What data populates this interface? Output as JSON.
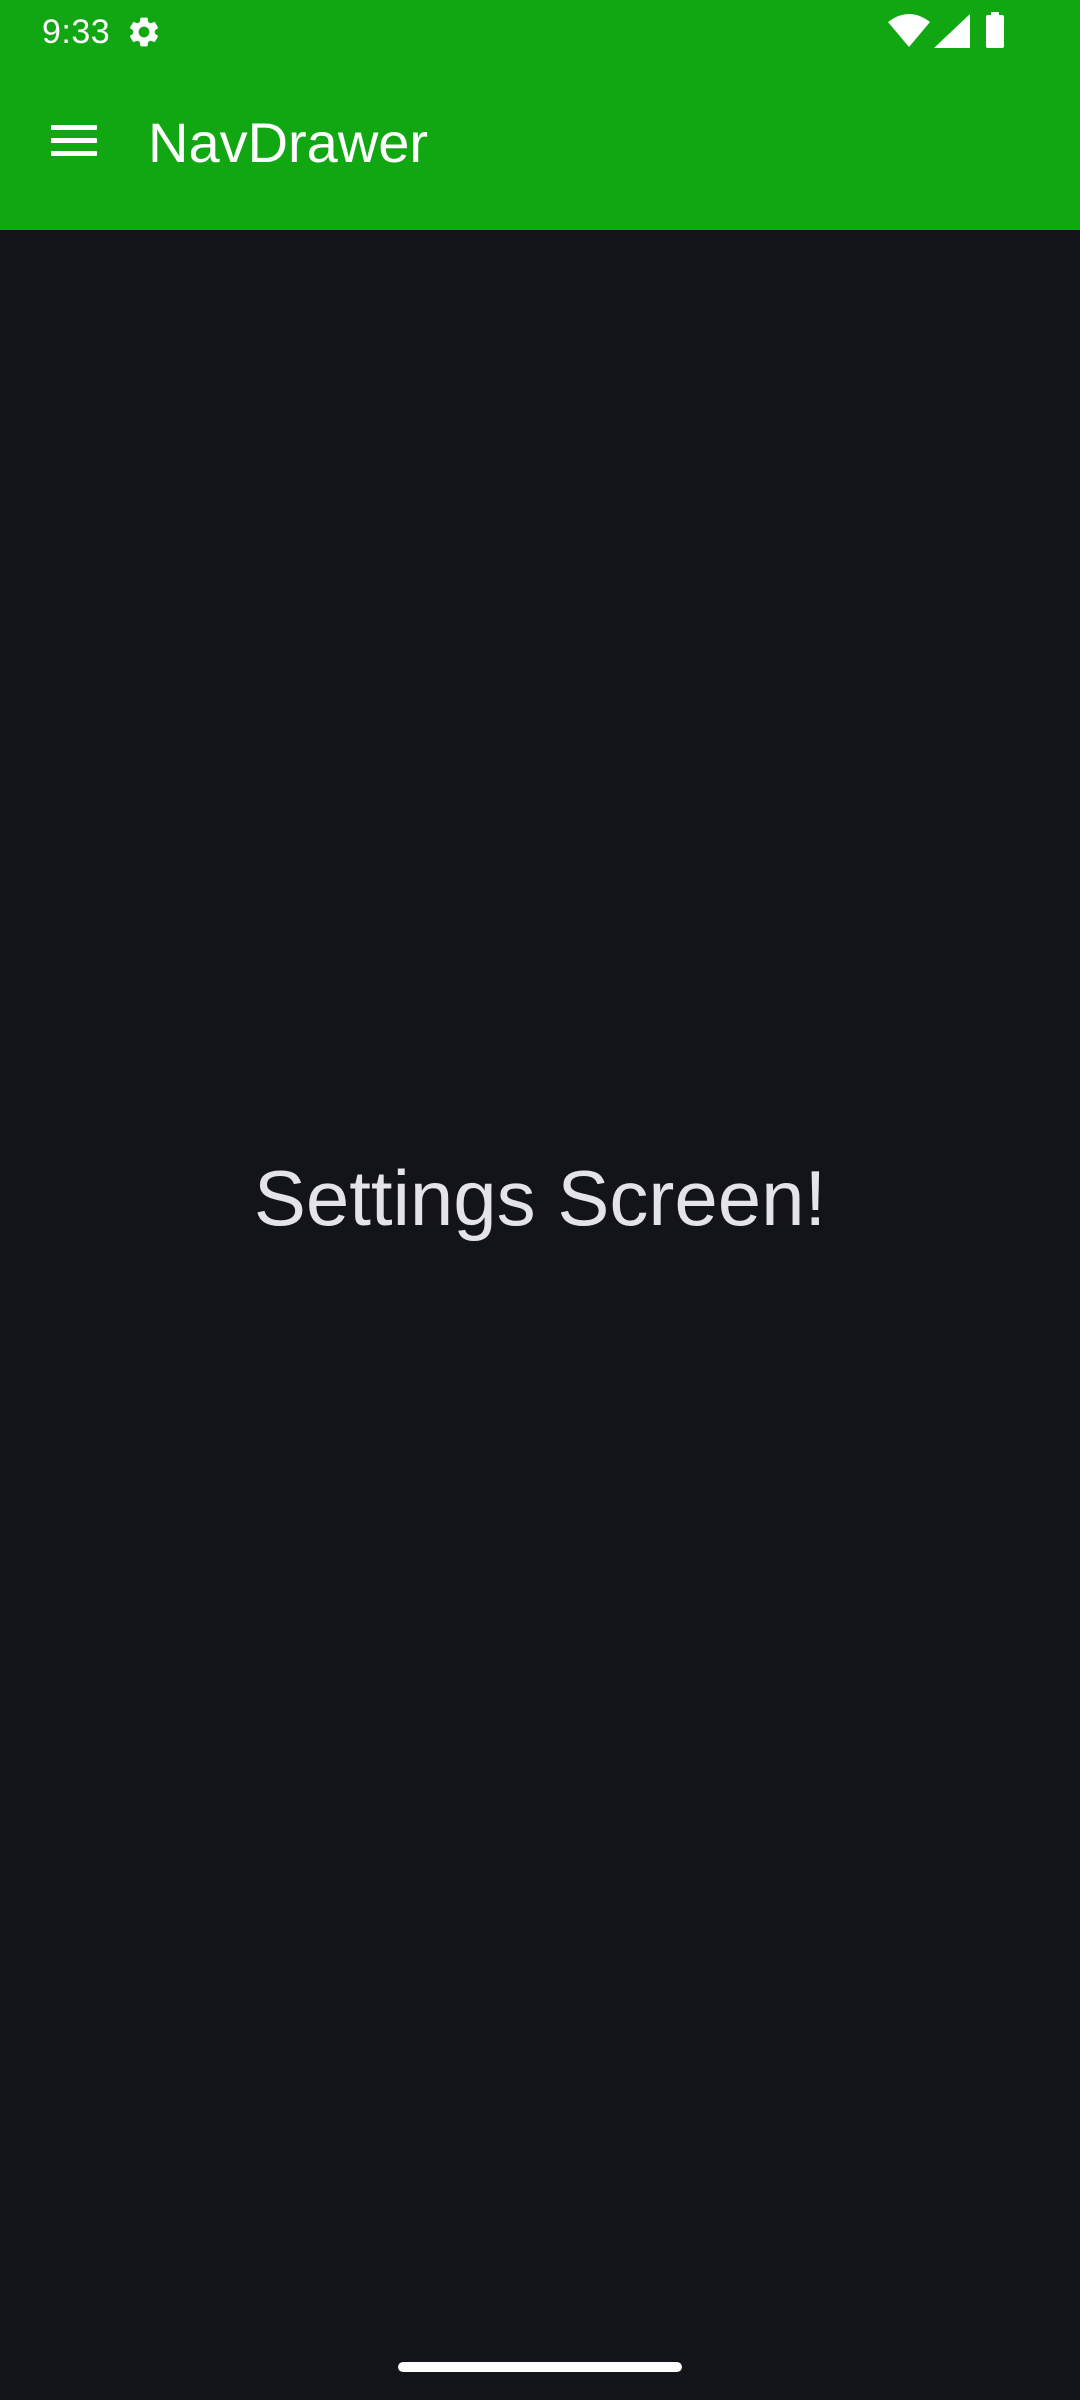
{
  "status_bar": {
    "time": "9:33",
    "icons": [
      "gear-icon",
      "wifi-icon",
      "signal-icon",
      "battery-icon"
    ]
  },
  "app_bar": {
    "title": "NavDrawer",
    "menu_icon": "hamburger-menu-icon"
  },
  "main": {
    "message": "Settings Screen!"
  },
  "colors": {
    "primary": "#11a713",
    "background": "#121419",
    "text": "#e3e3e8",
    "on_primary": "#ffffff"
  }
}
